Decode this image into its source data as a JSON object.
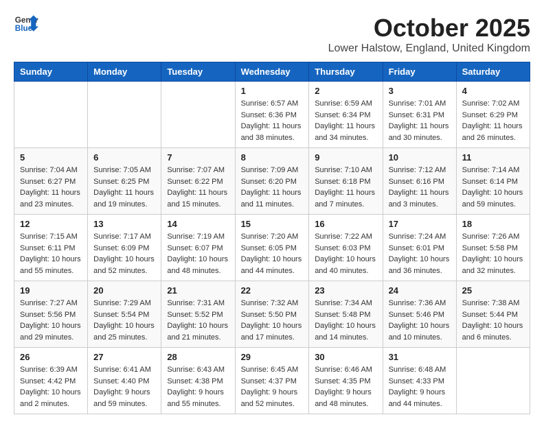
{
  "logo": {
    "line1": "General",
    "line2": "Blue"
  },
  "title": "October 2025",
  "location": "Lower Halstow, England, United Kingdom",
  "headers": [
    "Sunday",
    "Monday",
    "Tuesday",
    "Wednesday",
    "Thursday",
    "Friday",
    "Saturday"
  ],
  "weeks": [
    [
      {
        "day": "",
        "info": ""
      },
      {
        "day": "",
        "info": ""
      },
      {
        "day": "",
        "info": ""
      },
      {
        "day": "1",
        "info": "Sunrise: 6:57 AM\nSunset: 6:36 PM\nDaylight: 11 hours\nand 38 minutes."
      },
      {
        "day": "2",
        "info": "Sunrise: 6:59 AM\nSunset: 6:34 PM\nDaylight: 11 hours\nand 34 minutes."
      },
      {
        "day": "3",
        "info": "Sunrise: 7:01 AM\nSunset: 6:31 PM\nDaylight: 11 hours\nand 30 minutes."
      },
      {
        "day": "4",
        "info": "Sunrise: 7:02 AM\nSunset: 6:29 PM\nDaylight: 11 hours\nand 26 minutes."
      }
    ],
    [
      {
        "day": "5",
        "info": "Sunrise: 7:04 AM\nSunset: 6:27 PM\nDaylight: 11 hours\nand 23 minutes."
      },
      {
        "day": "6",
        "info": "Sunrise: 7:05 AM\nSunset: 6:25 PM\nDaylight: 11 hours\nand 19 minutes."
      },
      {
        "day": "7",
        "info": "Sunrise: 7:07 AM\nSunset: 6:22 PM\nDaylight: 11 hours\nand 15 minutes."
      },
      {
        "day": "8",
        "info": "Sunrise: 7:09 AM\nSunset: 6:20 PM\nDaylight: 11 hours\nand 11 minutes."
      },
      {
        "day": "9",
        "info": "Sunrise: 7:10 AM\nSunset: 6:18 PM\nDaylight: 11 hours\nand 7 minutes."
      },
      {
        "day": "10",
        "info": "Sunrise: 7:12 AM\nSunset: 6:16 PM\nDaylight: 11 hours\nand 3 minutes."
      },
      {
        "day": "11",
        "info": "Sunrise: 7:14 AM\nSunset: 6:14 PM\nDaylight: 10 hours\nand 59 minutes."
      }
    ],
    [
      {
        "day": "12",
        "info": "Sunrise: 7:15 AM\nSunset: 6:11 PM\nDaylight: 10 hours\nand 55 minutes."
      },
      {
        "day": "13",
        "info": "Sunrise: 7:17 AM\nSunset: 6:09 PM\nDaylight: 10 hours\nand 52 minutes."
      },
      {
        "day": "14",
        "info": "Sunrise: 7:19 AM\nSunset: 6:07 PM\nDaylight: 10 hours\nand 48 minutes."
      },
      {
        "day": "15",
        "info": "Sunrise: 7:20 AM\nSunset: 6:05 PM\nDaylight: 10 hours\nand 44 minutes."
      },
      {
        "day": "16",
        "info": "Sunrise: 7:22 AM\nSunset: 6:03 PM\nDaylight: 10 hours\nand 40 minutes."
      },
      {
        "day": "17",
        "info": "Sunrise: 7:24 AM\nSunset: 6:01 PM\nDaylight: 10 hours\nand 36 minutes."
      },
      {
        "day": "18",
        "info": "Sunrise: 7:26 AM\nSunset: 5:58 PM\nDaylight: 10 hours\nand 32 minutes."
      }
    ],
    [
      {
        "day": "19",
        "info": "Sunrise: 7:27 AM\nSunset: 5:56 PM\nDaylight: 10 hours\nand 29 minutes."
      },
      {
        "day": "20",
        "info": "Sunrise: 7:29 AM\nSunset: 5:54 PM\nDaylight: 10 hours\nand 25 minutes."
      },
      {
        "day": "21",
        "info": "Sunrise: 7:31 AM\nSunset: 5:52 PM\nDaylight: 10 hours\nand 21 minutes."
      },
      {
        "day": "22",
        "info": "Sunrise: 7:32 AM\nSunset: 5:50 PM\nDaylight: 10 hours\nand 17 minutes."
      },
      {
        "day": "23",
        "info": "Sunrise: 7:34 AM\nSunset: 5:48 PM\nDaylight: 10 hours\nand 14 minutes."
      },
      {
        "day": "24",
        "info": "Sunrise: 7:36 AM\nSunset: 5:46 PM\nDaylight: 10 hours\nand 10 minutes."
      },
      {
        "day": "25",
        "info": "Sunrise: 7:38 AM\nSunset: 5:44 PM\nDaylight: 10 hours\nand 6 minutes."
      }
    ],
    [
      {
        "day": "26",
        "info": "Sunrise: 6:39 AM\nSunset: 4:42 PM\nDaylight: 10 hours\nand 2 minutes."
      },
      {
        "day": "27",
        "info": "Sunrise: 6:41 AM\nSunset: 4:40 PM\nDaylight: 9 hours\nand 59 minutes."
      },
      {
        "day": "28",
        "info": "Sunrise: 6:43 AM\nSunset: 4:38 PM\nDaylight: 9 hours\nand 55 minutes."
      },
      {
        "day": "29",
        "info": "Sunrise: 6:45 AM\nSunset: 4:37 PM\nDaylight: 9 hours\nand 52 minutes."
      },
      {
        "day": "30",
        "info": "Sunrise: 6:46 AM\nSunset: 4:35 PM\nDaylight: 9 hours\nand 48 minutes."
      },
      {
        "day": "31",
        "info": "Sunrise: 6:48 AM\nSunset: 4:33 PM\nDaylight: 9 hours\nand 44 minutes."
      },
      {
        "day": "",
        "info": ""
      }
    ]
  ]
}
